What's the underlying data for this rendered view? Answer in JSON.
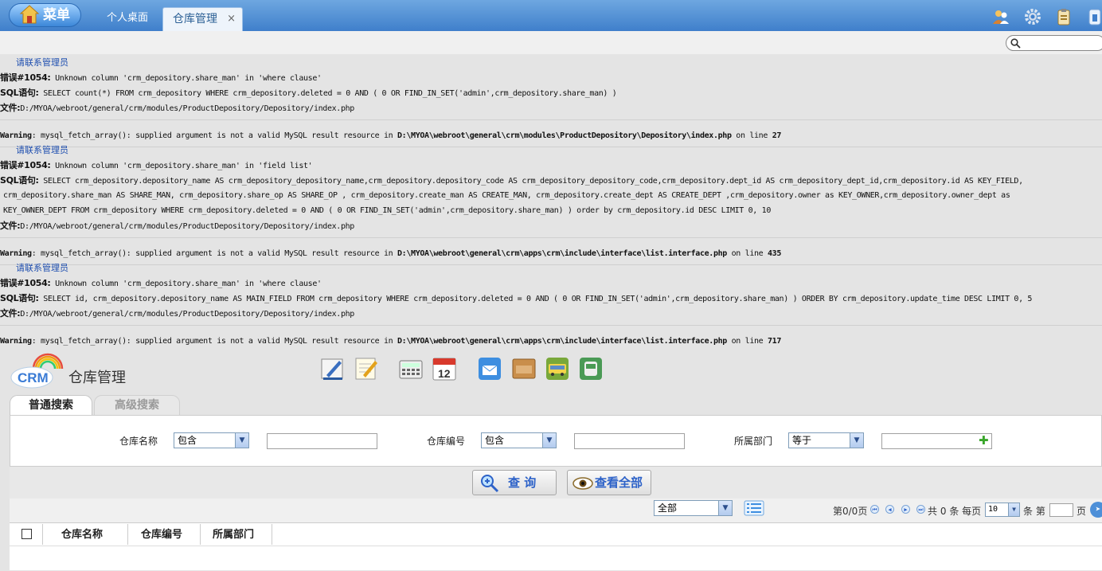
{
  "topbar": {
    "menu_label": "菜单",
    "tabs": [
      {
        "label": "个人桌面"
      },
      {
        "label": "仓库管理",
        "close": "×"
      }
    ],
    "icons": [
      "user-online-icon",
      "gear-icon",
      "clipboard-icon",
      "info-icon"
    ]
  },
  "errors": [
    {
      "admin_link": "请联系管理员",
      "error_label": "错误#1054:",
      "error_text": " Unknown column 'crm_depository.share_man' in 'where clause'",
      "sql_label": "SQL语句:",
      "sql_lines": [
        " SELECT count(*) FROM crm_depository WHERE crm_depository.deleted = 0 AND ( 0 OR FIND_IN_SET('admin',crm_depository.share_man) )"
      ],
      "file_label": "文件:",
      "file_text": "D:/MYOA/webroot/general/crm/modules/ProductDepository/Depository/index.php",
      "warning": {
        "label": "Warning",
        "text": ": mysql_fetch_array(): supplied argument is not a valid MySQL result resource in ",
        "path": "D:\\MYOA\\webroot\\general\\crm\\modules\\ProductDepository\\Depository\\index.php",
        "line_text": " on line ",
        "line": "27"
      }
    },
    {
      "admin_link": "请联系管理员",
      "error_label": "错误#1054:",
      "error_text": " Unknown column 'crm_depository.share_man' in 'field list'",
      "sql_label": "SQL语句:",
      "sql_lines": [
        " SELECT crm_depository.depository_name AS crm_depository_depository_name,crm_depository.depository_code AS crm_depository_depository_code,crm_depository.dept_id AS crm_depository_dept_id,crm_depository.id AS KEY_FIELD,",
        "crm_depository.share_man AS SHARE_MAN, crm_depository.share_op AS SHARE_OP , crm_depository.create_man AS CREATE_MAN, crm_depository.create_dept AS CREATE_DEPT ,crm_depository.owner as KEY_OWNER,crm_depository.owner_dept as",
        "KEY_OWNER_DEPT FROM crm_depository WHERE crm_depository.deleted = 0 AND ( 0 OR FIND_IN_SET('admin',crm_depository.share_man) ) order by crm_depository.id DESC LIMIT 0, 10"
      ],
      "file_label": "文件:",
      "file_text": "D:/MYOA/webroot/general/crm/modules/ProductDepository/Depository/index.php",
      "warning": {
        "label": "Warning",
        "text": ": mysql_fetch_array(): supplied argument is not a valid MySQL result resource in ",
        "path": "D:\\MYOA\\webroot\\general\\crm\\apps\\crm\\include\\interface\\list.interface.php",
        "line_text": " on line ",
        "line": "435"
      }
    },
    {
      "admin_link": "请联系管理员",
      "error_label": "错误#1054:",
      "error_text": " Unknown column 'crm_depository.share_man' in 'where clause'",
      "sql_label": "SQL语句:",
      "sql_lines": [
        " SELECT id, crm_depository.depository_name AS MAIN_FIELD FROM crm_depository WHERE crm_depository.deleted = 0 AND ( 0 OR FIND_IN_SET('admin',crm_depository.share_man) ) ORDER BY crm_depository.update_time DESC LIMIT 0, 5"
      ],
      "file_label": "文件:",
      "file_text": "D:/MYOA/webroot/general/crm/modules/ProductDepository/Depository/index.php",
      "warning": {
        "label": "Warning",
        "text": ": mysql_fetch_array(): supplied argument is not a valid MySQL result resource in ",
        "path": "D:\\MYOA\\webroot\\general\\crm\\apps\\crm\\include\\interface\\list.interface.php",
        "line_text": " on line ",
        "line": "717"
      }
    }
  ],
  "module": {
    "logo_text": "CRM",
    "title": "仓库管理",
    "toolbar_icons": [
      "edit-icon",
      "note-icon",
      "calculator-icon",
      "calendar-icon",
      "mail-icon",
      "package-icon",
      "bus-icon",
      "train-icon"
    ],
    "calendar_day": "12"
  },
  "search": {
    "tabs": [
      "普通搜索",
      "高级搜索"
    ],
    "fields": [
      {
        "label": "仓库名称",
        "operator": "包含",
        "value": ""
      },
      {
        "label": "仓库编号",
        "operator": "包含",
        "value": ""
      },
      {
        "label": "所属部门",
        "operator": "等于",
        "value": ""
      }
    ],
    "query_button": "查 询",
    "view_all_button": "查看全部"
  },
  "pager": {
    "filter": "全部",
    "page_info": "第0/0页",
    "total_prefix": "共",
    "total": "0",
    "total_suffix": "条 每页",
    "per_page": "10",
    "per_page_suffix": "条 第",
    "page_suffix": "页"
  },
  "table": {
    "columns": [
      "仓库名称",
      "仓库编号",
      "所属部门"
    ]
  },
  "colors": {
    "topbar": "#3f7fcb",
    "link": "#1f4fb0",
    "button_text": "#2d62c8"
  }
}
